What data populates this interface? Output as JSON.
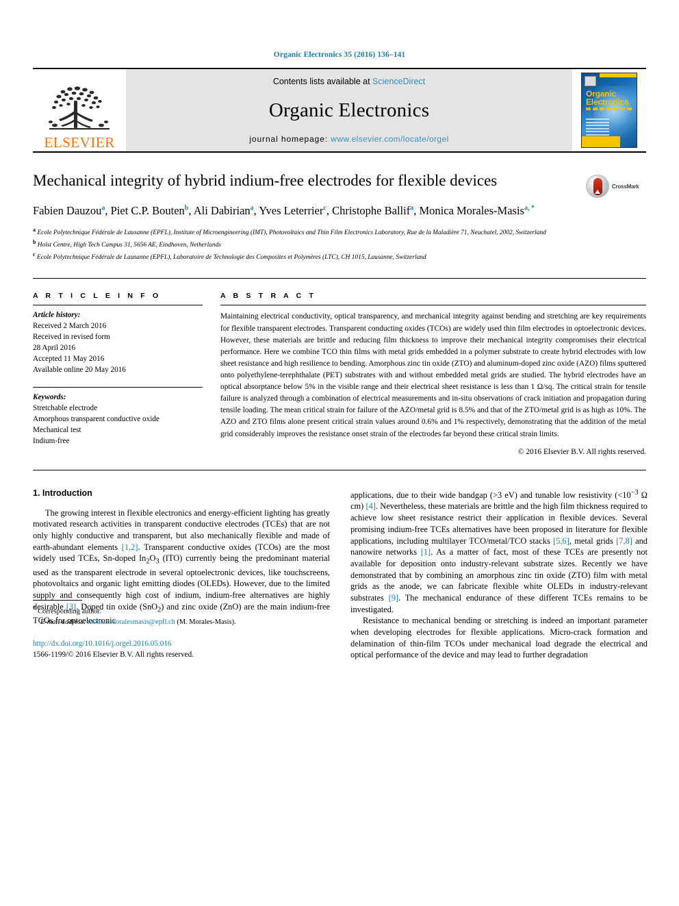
{
  "running_head": "Organic Electronics 35 (2016) 136–141",
  "banner": {
    "publisher": "ELSEVIER",
    "contents_prefix": "Contents lists available at ",
    "contents_link": "ScienceDirect",
    "journal_name": "Organic Electronics",
    "homepage_prefix": "journal homepage: ",
    "homepage_url": "www.elsevier.com/locate/orgel",
    "cover_title_line1": "Organic",
    "cover_title_line2": "Electronics"
  },
  "article": {
    "title": "Mechanical integrity of hybrid indium-free electrodes for flexible devices",
    "crossmark_label": "CrossMark",
    "authors": [
      {
        "name": "Fabien Dauzou",
        "marker": "a",
        "sep": ", "
      },
      {
        "name": "Piet C.P. Bouten",
        "marker": "b",
        "sep": ", "
      },
      {
        "name": "Ali Dabirian",
        "marker": "a",
        "sep": ", "
      },
      {
        "name": "Yves Leterrier",
        "marker": "c",
        "sep": ", "
      },
      {
        "name": "Christophe Ballif",
        "marker": "a",
        "sep": ", "
      },
      {
        "name": "Monica Morales-Masis",
        "marker": "a, *",
        "sep": ""
      }
    ],
    "affiliations": [
      {
        "marker": "a",
        "text": "Ecole Polytechnique Fédérale de Lausanne (EPFL), Institute of Microengineering (IMT), Photovoltaics and Thin Film Electronics Laboratory, Rue de la Maladière 71, Neuchatel, 2002, Switzerland"
      },
      {
        "marker": "b",
        "text": "Holst Centre, High Tech Campus 31, 5656 AE, Eindhoven, Netherlands"
      },
      {
        "marker": "c",
        "text": "Ecole Polytechnique Fédérale de Lausanne (EPFL), Laboratoire de Technologie des Composites et Polymères (LTC), CH 1015, Lausanne, Switzerland"
      }
    ]
  },
  "article_info": {
    "heading": "A R T I C L E  I N F O",
    "history_label": "Article history:",
    "history": [
      "Received 2 March 2016",
      "Received in revised form",
      "28 April 2016",
      "Accepted 11 May 2016",
      "Available online 20 May 2016"
    ],
    "keywords_label": "Keywords:",
    "keywords": [
      "Stretchable electrode",
      "Amorphous transparent conductive oxide",
      "Mechanical test",
      "Indium-free"
    ]
  },
  "abstract": {
    "heading": "A B S T R A C T",
    "text": "Maintaining electrical conductivity, optical transparency, and mechanical integrity against bending and stretching are key requirements for flexible transparent electrodes. Transparent conducting oxides (TCOs) are widely used thin film electrodes in optoelectronic devices. However, these materials are brittle and reducing film thickness to improve their mechanical integrity compromises their electrical performance. Here we combine TCO thin films with metal grids embedded in a polymer substrate to create hybrid electrodes with low sheet resistance and high resilience to bending. Amorphous zinc tin oxide (ZTO) and aluminum-doped zinc oxide (AZO) films sputtered onto polyethylene-terephthalate (PET) substrates with and without embedded metal grids are studied. The hybrid electrodes have an optical absorptance below 5% in the visible range and their electrical sheet resistance is less than 1 Ω/sq. The critical strain for tensile failure is analyzed through a combination of electrical measurements and in-situ observations of crack initiation and propagation during tensile loading. The mean critical strain for failure of the AZO/metal grid is 8.5% and that of the ZTO/metal grid is as high as 10%. The AZO and ZTO films alone present critical strain values around 0.6% and 1% respectively, demonstrating that the addition of the metal grid considerably improves the resistance onset strain of the electrodes far beyond these critical strain limits.",
    "copyright": "© 2016 Elsevier B.V. All rights reserved."
  },
  "introduction": {
    "section_number": "1.",
    "section_title": "Introduction",
    "left_column": {
      "para1_part1": "The growing interest in flexible electronics and energy-efficient lighting has greatly motivated research activities in transparent conductive electrodes (TCEs) that are not only highly conductive and transparent, but also mechanically flexible and made of earth-abundant elements ",
      "cite1": "[1,2]",
      "para1_part2": ". Transparent conductive oxides (TCOs) are the most widely used TCEs, Sn-doped In",
      "sub1": "2",
      "para1_part3": "O",
      "sub2": "3",
      "para1_part4": " (ITO) currently being the predominant material used as the transparent electrode in several optoelectronic devices, like touchscreens, photovoltaics and organic light emitting diodes (OLEDs). However, due to the limited supply and consequently high cost of indium, indium-free alternatives are highly desirable ",
      "cite2": "[3]",
      "para1_part5": ". Doped tin oxide (SnO",
      "sub3": "2",
      "para1_part6": ") and zinc oxide (ZnO) are the main indium-free TCOs for optoelectronic"
    },
    "right_column": {
      "cont_part1": "applications, due to their wide bandgap (>3 eV) and tunable low resistivity (<10",
      "sup1": "−3",
      "cont_part2": " Ω cm) ",
      "cite4": "[4]",
      "cont_part3": ". Nevertheless, these materials are brittle and the high film thickness required to achieve low sheet resistance restrict their application in flexible devices. Several promising indium-free TCEs alternatives have been proposed in literature for flexible applications, including multilayer TCO/metal/TCO stacks ",
      "cite56": "[5,6]",
      "cont_part4": ", metal grids ",
      "cite78": "[7,8]",
      "cont_part5": " and nanowire networks ",
      "cite1b": "[1]",
      "cont_part6": ". As a matter of fact, most of these TCEs are presently not available for deposition onto industry-relevant substrate sizes. Recently we have demonstrated that by combining an amorphous zinc tin oxide (ZTO) film with metal grids as the anode, we can fabricate flexible white OLEDs in industry-relevant substrates ",
      "cite9": "[9]",
      "cont_part7": ". The mechanical endurance of these different TCEs remains to be investigated.",
      "para2": "Resistance to mechanical bending or stretching is indeed an important parameter when developing electrodes for flexible applications. Micro-crack formation and delamination of thin-film TCOs under mechanical load degrade the electrical and optical performance of the device and may lead to further degradation"
    }
  },
  "footnote": {
    "star": "*",
    "corresponding": " Corresponding author.",
    "email_label": "E-mail address: ",
    "email": "monica.moralesmasis@epfl.ch",
    "email_suffix": " (M. Morales-Masis).",
    "doi": "http://dx.doi.org/10.1016/j.orgel.2016.05.016",
    "issn_line": "1566-1199/© 2016 Elsevier B.V. All rights reserved."
  },
  "colors": {
    "link": "#1a7fb5",
    "elsevier_orange": "#e8751a",
    "banner_gray": "#e4e4e4"
  }
}
